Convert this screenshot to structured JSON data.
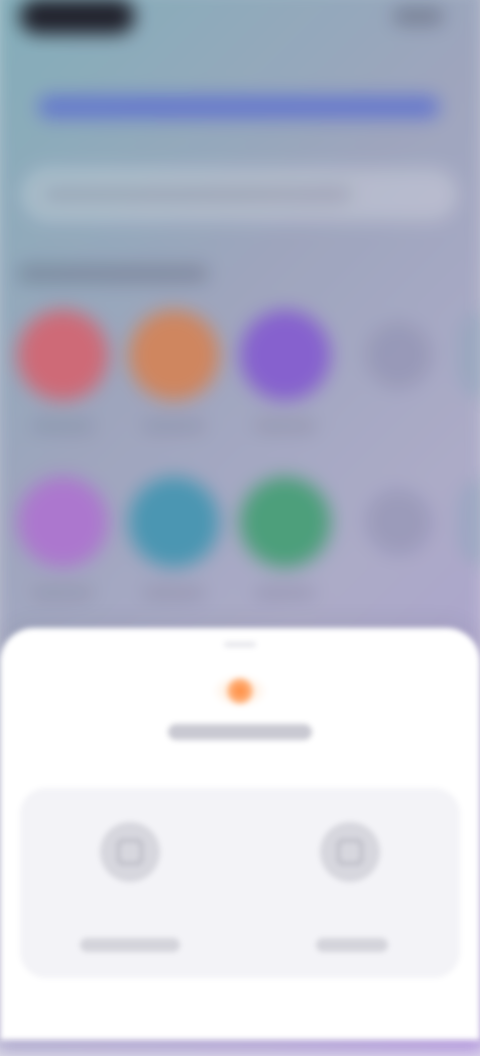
{
  "background": {
    "gradient_colors": [
      "#86b6c0",
      "#a4acc4",
      "#b6a8d8",
      "#b79ce0"
    ],
    "accent_color": "#5e72d8",
    "app_icons_row_1": [
      {
        "icon": "app-icon-red",
        "color": "#d86c78"
      },
      {
        "icon": "app-icon-orange",
        "color": "#d98a5e"
      },
      {
        "icon": "app-icon-purple",
        "color": "#8a62d6"
      }
    ],
    "app_icons_row_2": [
      {
        "icon": "app-icon-magenta",
        "color": "#b37ad6"
      },
      {
        "icon": "app-icon-teal",
        "color": "#4a9cb8"
      },
      {
        "icon": "app-icon-green",
        "color": "#4ca57c"
      }
    ]
  },
  "sheet": {
    "badge_icon": "spark-icon",
    "badge_color": "#ff8a3c",
    "options": [
      {
        "icon": "option-icon"
      },
      {
        "icon": "option-icon"
      }
    ]
  }
}
